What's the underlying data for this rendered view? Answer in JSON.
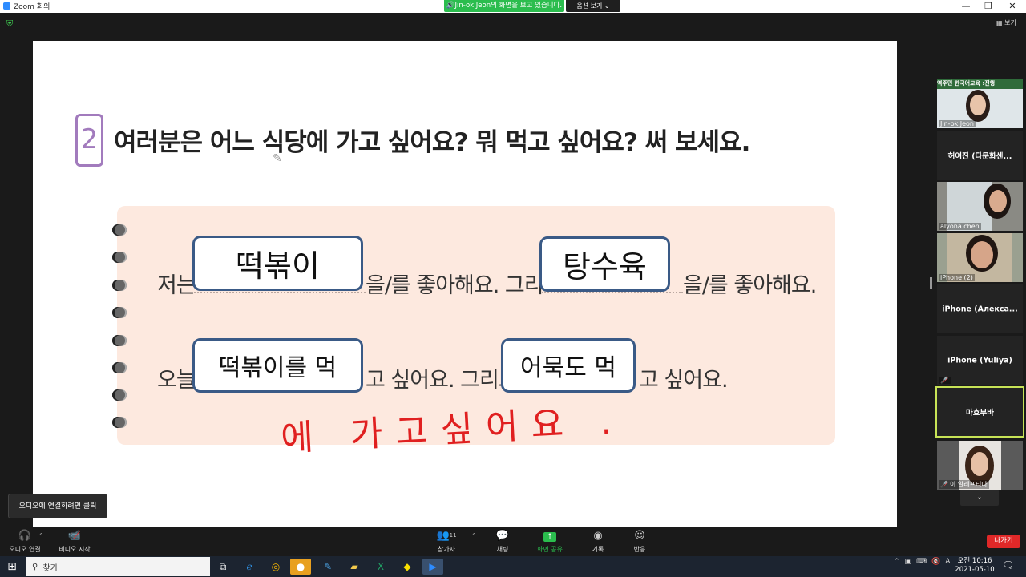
{
  "window": {
    "title": "Zoom 회의",
    "share_banner": "Jin-ok  Jeon의 화면을 보고 있습니다.",
    "view_options": "옵션 보기 ⌄",
    "controls": {
      "minimize": "—",
      "restore": "❐",
      "close": "✕"
    }
  },
  "meeting": {
    "grid_view_label": "보기"
  },
  "worksheet": {
    "question_number": "2",
    "question": "여러분은 어느 식당에 가고 싶어요? 뭐 먹고 싶어요? 써 보세요.",
    "line1": {
      "prefix": "저는",
      "answer1": "떡볶이",
      "middle": "을/를 좋아해요. 그리고",
      "answer2": "탕수육",
      "suffix": "을/를 좋아해요."
    },
    "line2": {
      "prefix": "오늘",
      "answer1": "떡볶이를 먹",
      "middle": "고 싶어요. 그리고",
      "answer2": "어묵도 먹",
      "suffix": "고 싶어요."
    },
    "handwriting": "에 가고싶어요 ."
  },
  "gallery": {
    "participants": [
      {
        "name": "Jin-ok Jeon",
        "type": "video",
        "banner": "역주민 한국어교육 :진행"
      },
      {
        "name": "허여진 (다문화센...",
        "type": "name"
      },
      {
        "name": "alyona chen",
        "type": "video"
      },
      {
        "name": "iPhone (2)",
        "type": "video"
      },
      {
        "name": "iPhone  (Алекса...",
        "type": "name"
      },
      {
        "name": "iPhone (Yuliya)",
        "type": "name",
        "muted": true
      },
      {
        "name": "마흐부바",
        "type": "name",
        "active": true
      },
      {
        "name": "이 알레프티나",
        "type": "video",
        "muted": true
      }
    ],
    "more_icon": "chevron-down-icon"
  },
  "tooltip": "오디오에 연결하려면 클릭",
  "toolbar": {
    "audio": "오디오 연결",
    "video": "비디오 시작",
    "participants": "참가자",
    "participants_count": "11",
    "chat": "채팅",
    "share": "화면 공유",
    "record": "기록",
    "reactions": "반응",
    "leave": "나가기"
  },
  "taskbar": {
    "search_placeholder": "찾기",
    "ime": "A",
    "time": "오전 10:16",
    "date": "2021-05-10"
  },
  "colors": {
    "share_green": "#2bbd4e",
    "leave_red": "#e02828",
    "active_speaker": "#c7e356",
    "answer_border": "#3a5a86",
    "handwriting": "#e02020"
  }
}
